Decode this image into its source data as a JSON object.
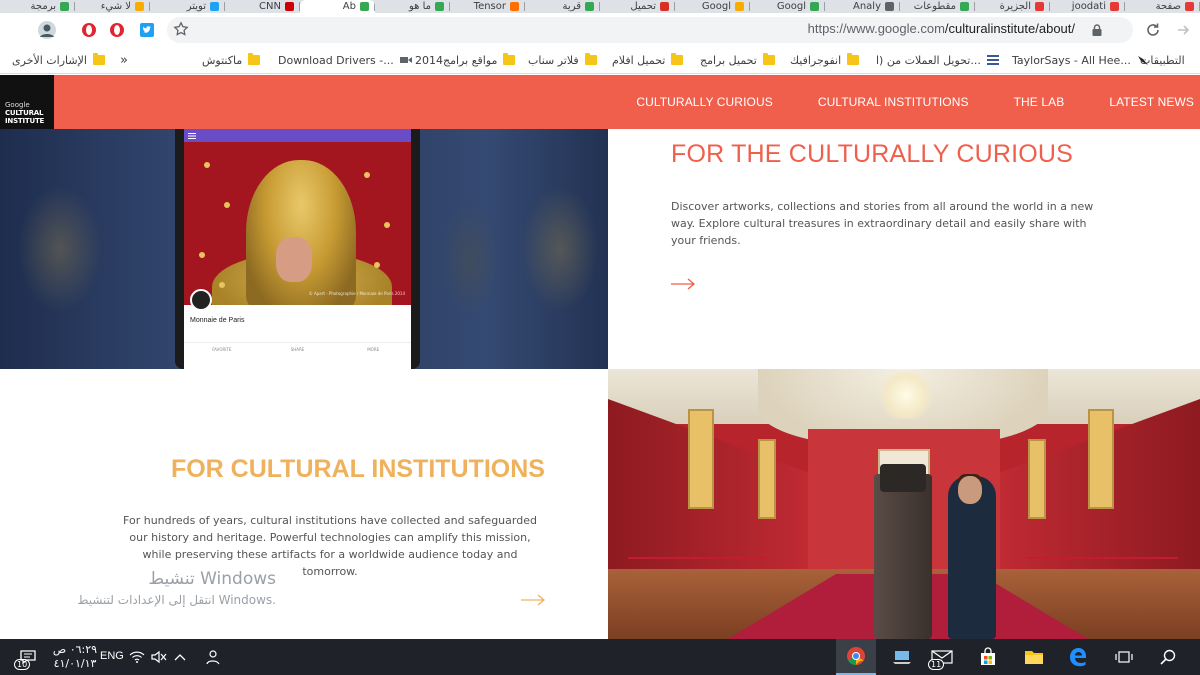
{
  "browser": {
    "tabs": [
      {
        "title": "صفحة",
        "favicon_color": "#e53935"
      },
      {
        "title": "joodati",
        "favicon_color": "#e53935"
      },
      {
        "title": "الجزيرة",
        "favicon_color": "#e53935"
      },
      {
        "title": "مقطوعات",
        "favicon_color": "#34a853"
      },
      {
        "title": "Analy",
        "favicon_color": "#5f6368"
      },
      {
        "title": "Googl",
        "favicon_color": "#34a853"
      },
      {
        "title": "Googl",
        "favicon_color": "#f9ab00"
      },
      {
        "title": "تحميل",
        "favicon_color": "#d93025"
      },
      {
        "title": "قرية",
        "favicon_color": "#34a853"
      },
      {
        "title": "Tensor",
        "favicon_color": "#ff6f00"
      },
      {
        "title": "ما هو",
        "favicon_color": "#34a853"
      },
      {
        "title": "Ab",
        "favicon_color": "#34a853",
        "active": true
      },
      {
        "title": "CNN",
        "favicon_color": "#cc0000"
      },
      {
        "title": "تويتر",
        "favicon_color": "#1da1f2"
      },
      {
        "title": "لا شيء",
        "favicon_color": "#f9ab00"
      },
      {
        "title": "برمجة",
        "favicon_color": "#34a853"
      }
    ],
    "url_host": "https://www.google.com",
    "url_path": "/culturalinstitute/about/",
    "bookmarks": {
      "left_overflow": "»",
      "other_bookmarks": "الإشارات الأخرى",
      "items": [
        {
          "label": "ماكنتوش",
          "icon": "folder-icon"
        },
        {
          "label": "Download Drivers -...",
          "icon": "download-icon"
        },
        {
          "label": "مواقع برامج2014",
          "icon": "folder-icon"
        },
        {
          "label": "فلاتر سناب",
          "icon": "folder-icon"
        },
        {
          "label": "تحميل افلام",
          "icon": "folder-icon"
        },
        {
          "label": "تحميل برامج",
          "icon": "folder-icon"
        },
        {
          "label": "انفوجرافيك",
          "icon": "folder-icon"
        },
        {
          "label": "تحويل العملات من (ا...",
          "icon": "folder-icon"
        },
        {
          "label": "TaylorSays - All Hee...",
          "icon": "list-icon"
        },
        {
          "label": "التطبيقات",
          "icon": "apps-icon"
        }
      ]
    }
  },
  "site": {
    "logo_line1": "Google",
    "logo_line2": "CULTURAL",
    "logo_line3": "INSTITUTE",
    "nav": [
      "CULTURALLY CURIOUS",
      "CULTURAL INSTITUTIONS",
      "THE LAB",
      "LATEST NEWS"
    ],
    "colors": {
      "accent": "#ef5f4c",
      "institutions": "#f0b15c"
    },
    "curious": {
      "title": "FOR THE CULTURALLY CURIOUS",
      "text": "Discover artworks, collections and stories from all around the world in a new way. Explore cultural treasures in extraordinary detail and easily share with your friends."
    },
    "phone": {
      "card_title": "Monnaie de Paris",
      "photo_credit": "© Apart - Photographie / Monnaie de Paris 2014",
      "actions": [
        "FAVORITE",
        "SHARE",
        "MORE"
      ]
    },
    "institutions": {
      "title": "FOR CULTURAL INSTITUTIONS",
      "text": "For hundreds of years, cultural institutions have collected and safeguarded our history and heritage. Powerful technologies can amplify this mission, while preserving these artifacts for a worldwide audience today and tomorrow."
    }
  },
  "windows_watermark": {
    "line1": "تنشيط Windows",
    "line2": "انتقل إلى الإعدادات لتنشيط Windows."
  },
  "taskbar": {
    "time": "٠٦:٢٩ ص",
    "date": "٤١/٠١/١٣",
    "language": "ENG",
    "notification_count": "10",
    "mail_count": "11"
  }
}
